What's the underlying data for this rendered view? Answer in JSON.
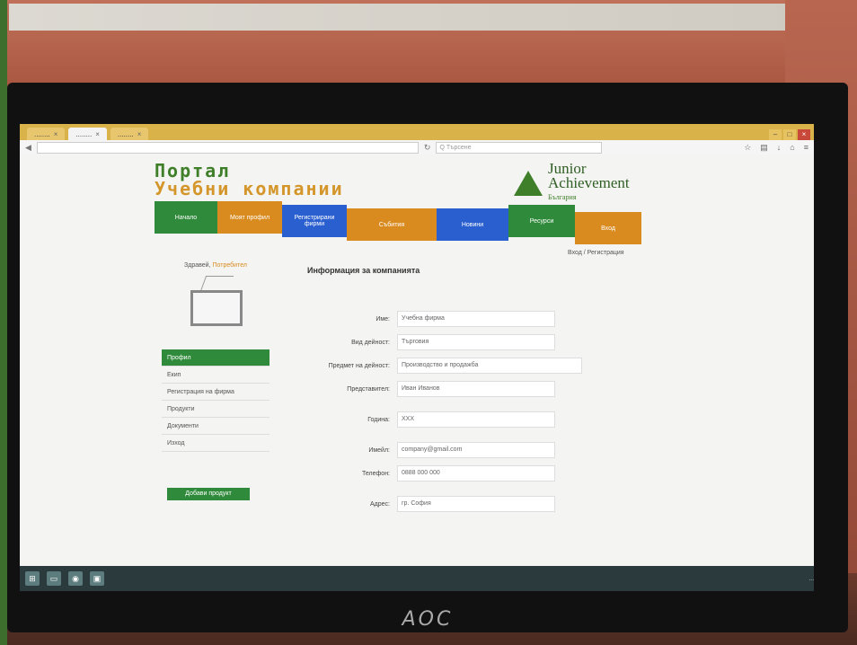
{
  "browser": {
    "tabs": [
      {
        "label": "........"
      },
      {
        "label": "........"
      },
      {
        "label": "........"
      }
    ],
    "active_tab": 1,
    "url": "",
    "search_placeholder": "Q Търсене"
  },
  "page": {
    "title_line1": "Портал",
    "title_line2": "Учебни компании",
    "logo": {
      "line1": "Junior",
      "line2": "Achievement",
      "line3": "България"
    },
    "nav": [
      {
        "label": "Начало",
        "color": "green"
      },
      {
        "label": "Моят профил",
        "color": "orange"
      },
      {
        "label": "Регистрирани фирми",
        "color": "blue"
      },
      {
        "label": "Събития",
        "color": "orange"
      },
      {
        "label": "Новини",
        "color": "blue"
      },
      {
        "label": "Ресурси",
        "color": "green"
      },
      {
        "label": "Вход",
        "color": "orange"
      }
    ],
    "nav_sub": "Вход / Регистрация",
    "sidebar": {
      "header": "Здравей,",
      "header_highlight": "Потребител",
      "items": [
        {
          "label": "Профил",
          "active": true
        },
        {
          "label": "Екип"
        },
        {
          "label": "Регистрация на фирма"
        },
        {
          "label": "Продукти"
        },
        {
          "label": "Документи"
        },
        {
          "label": "Изход"
        }
      ],
      "button": "Добави продукт"
    },
    "content": {
      "title": "Информация за компанията",
      "fields": [
        {
          "label": "Име:",
          "value": "Учебна фирма"
        },
        {
          "label": "Вид дейност:",
          "value": "Търговия"
        },
        {
          "label": "Предмет на дейност:",
          "value": "Производство и продажба"
        },
        {
          "label": "Представител:",
          "value": "Иван Иванов"
        },
        {
          "label": "Година:",
          "value": "ХХХ"
        },
        {
          "label": "Имейл:",
          "value": "company@gmail.com"
        },
        {
          "label": "Телефон:",
          "value": "0888 000 000"
        },
        {
          "label": "Адрес:",
          "value": "гр. София"
        }
      ]
    }
  },
  "monitor": {
    "brand": "AOC"
  },
  "taskbar": {
    "status": "......"
  }
}
